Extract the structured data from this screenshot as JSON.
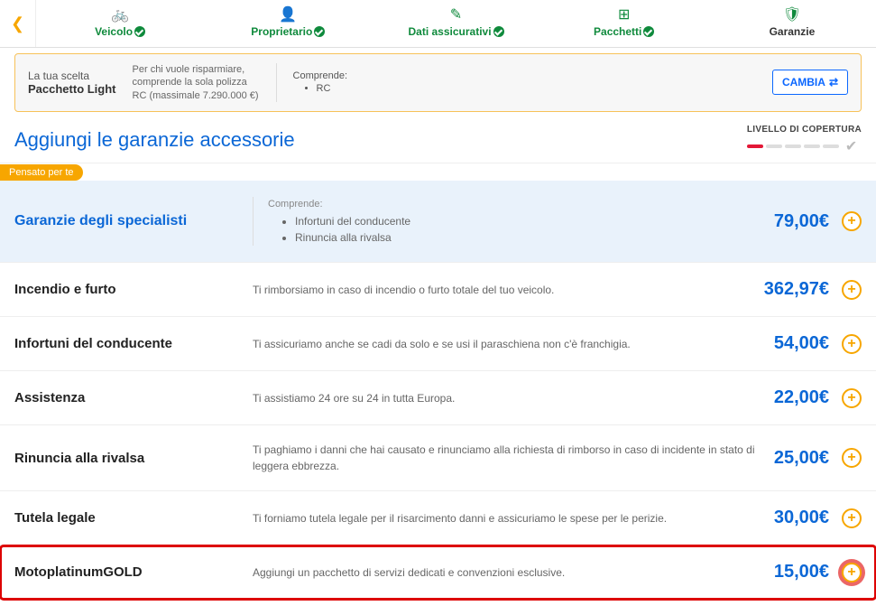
{
  "wizard": {
    "steps": [
      {
        "label": "Veicolo"
      },
      {
        "label": "Proprietario"
      },
      {
        "label": "Dati assicurativi"
      },
      {
        "label": "Pacchetti"
      },
      {
        "label": "Garanzie"
      }
    ]
  },
  "choice": {
    "line1": "La tua scelta",
    "line2": "Pacchetto Light",
    "desc": "Per chi vuole risparmiare, comprende la sola polizza RC (massimale 7.290.000 €)",
    "includes_label": "Comprende:",
    "includes_item1": "RC",
    "change_label": "CAMBIA"
  },
  "section_title": "Aggiungi le garanzie accessorie",
  "coverage_label": "LIVELLO DI COPERTURA",
  "featured_badge": "Pensato per te",
  "garanzie": [
    {
      "name": "Garanzie degli specialisti",
      "price": "79,00€",
      "featured": true,
      "includes_hd": "Comprende:",
      "inc1": "Infortuni del conducente",
      "inc2": "Rinuncia alla rivalsa"
    },
    {
      "name": "Incendio e furto",
      "desc": "Ti rimborsiamo in caso di incendio o furto totale del tuo veicolo.",
      "price": "362,97€"
    },
    {
      "name": "Infortuni del conducente",
      "desc": "Ti assicuriamo anche se cadi da solo e se usi il paraschiena non c'è franchigia.",
      "price": "54,00€"
    },
    {
      "name": "Assistenza",
      "desc": "Ti assistiamo 24 ore su 24 in tutta Europa.",
      "price": "22,00€"
    },
    {
      "name": "Rinuncia alla rivalsa",
      "desc": "Ti paghiamo i danni che hai causato e rinunciamo alla richiesta di rimborso in caso di incidente in stato di leggera ebbrezza.",
      "price": "25,00€"
    },
    {
      "name": "Tutela legale",
      "desc": "Ti forniamo tutela legale per il risarcimento danni e assicuriamo le spese per le perizie.",
      "price": "30,00€"
    },
    {
      "name": "MotoplatinumGOLD",
      "desc": "Aggiungi un pacchetto di servizi dedicati e convenzioni esclusive.",
      "price": "15,00€",
      "highlighted": true
    }
  ]
}
